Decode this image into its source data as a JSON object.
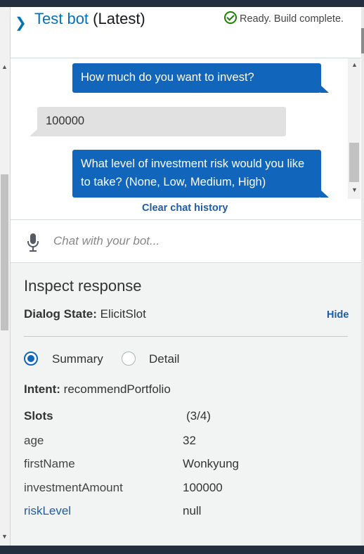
{
  "header": {
    "title_link": "Test bot",
    "title_suffix": "(Latest)",
    "status": "Ready. Build complete."
  },
  "chat": {
    "messages": [
      {
        "from": "bot",
        "text": "How much do you want to invest?"
      },
      {
        "from": "user",
        "text": "100000"
      },
      {
        "from": "bot",
        "text": "What level of investment risk would you like to take? (None, Low, Medium, High)"
      }
    ],
    "clear_label": "Clear chat history"
  },
  "input": {
    "placeholder": "Chat with your bot..."
  },
  "inspect": {
    "title": "Inspect response",
    "dialog_label": "Dialog State:",
    "dialog_value": "ElicitSlot",
    "hide_label": "Hide",
    "options": [
      "Summary",
      "Detail"
    ],
    "selected_option": "Summary",
    "intent_label": "Intent:",
    "intent_value": "recommendPortfolio",
    "slots_label": "Slots",
    "slots_count": "(3/4)",
    "slots": [
      {
        "name": "age",
        "value": "32"
      },
      {
        "name": "firstName",
        "value": "Wonkyung"
      },
      {
        "name": "investmentAmount",
        "value": "100000"
      },
      {
        "name": "riskLevel",
        "value": "null"
      }
    ]
  },
  "colors": {
    "accent": "#0073bb",
    "bot_bubble": "#1166bb",
    "user_bubble": "#e1e1e1",
    "success": "#1d8102",
    "panel_bg": "#f2f3f3"
  }
}
